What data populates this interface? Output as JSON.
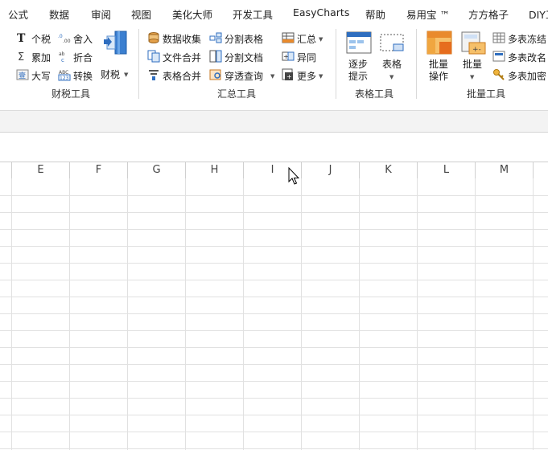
{
  "menu": {
    "tabs": [
      "公式",
      "数据",
      "审阅",
      "视图",
      "美化大师",
      "开发工具",
      "EasyCharts",
      "帮助",
      "易用宝 ™",
      "方方格子",
      "DIY工"
    ]
  },
  "ribbon": {
    "tax_group": {
      "label": "财税工具",
      "items": [
        "个税",
        "累加",
        "大写",
        "舍入",
        "折合",
        "转换"
      ],
      "big_button": "财税"
    },
    "summary_group": {
      "label": "汇总工具",
      "items": [
        "数据收集",
        "文件合并",
        "表格合并",
        "分割表格",
        "分割文档",
        "穿透查询",
        "汇总",
        "异同",
        "更多"
      ]
    },
    "table_group": {
      "label": "表格工具",
      "buttons": [
        {
          "line1": "逐步",
          "line2": "提示"
        },
        {
          "line1": "表格",
          "line2": ""
        }
      ]
    },
    "batch_group": {
      "label": "批量工具",
      "buttons": [
        {
          "line1": "批量",
          "line2": "操作"
        },
        {
          "line1": "批量",
          "line2": ""
        }
      ],
      "items": [
        "多表冻结",
        "多表改名",
        "多表加密"
      ]
    }
  },
  "sheet": {
    "columns": [
      "E",
      "F",
      "G",
      "H",
      "I",
      "J",
      "K",
      "L",
      "M"
    ],
    "visible_rows": 16
  },
  "colors": {
    "accent_blue": "#2f6ebf",
    "accent_orange": "#e98a2c",
    "grid_line": "#e1e1e1",
    "header_text": "#444444"
  }
}
